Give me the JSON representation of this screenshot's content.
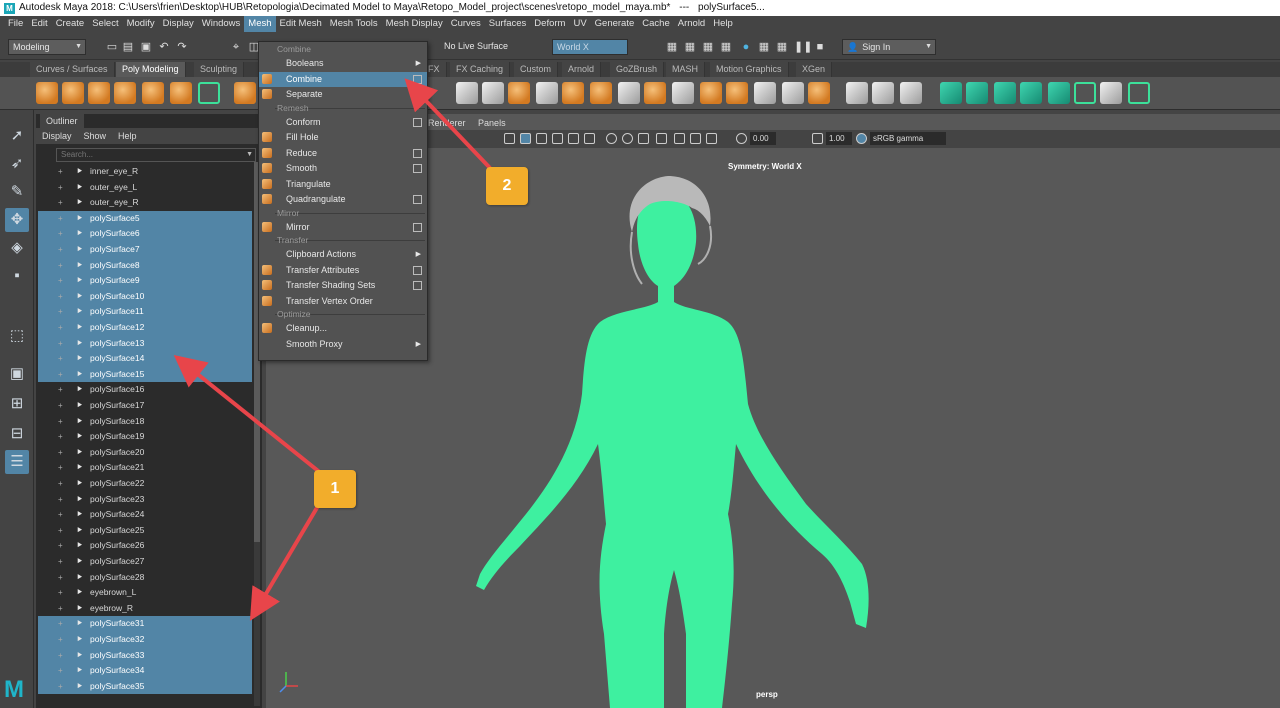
{
  "title": {
    "app": "Autodesk Maya 2018: C:\\Users\\frien\\Desktop\\HUB\\Retopologia\\Decimated Model to Maya\\Retopo_Model_project\\scenes\\retopo_model_maya.mb*",
    "separator": "---",
    "object": "polySurface5..."
  },
  "menubar": [
    "File",
    "Edit",
    "Create",
    "Select",
    "Modify",
    "Display",
    "Windows",
    "Mesh",
    "Edit Mesh",
    "Mesh Tools",
    "Mesh Display",
    "Curves",
    "Surfaces",
    "Deform",
    "UV",
    "Generate",
    "Cache",
    "Arnold",
    "Help"
  ],
  "active_menu": "Mesh",
  "statusline": {
    "mode": "Modeling",
    "live_surface": "No Live Surface",
    "symmetry": "World X",
    "sign_in": "Sign In"
  },
  "shelf_tabs": [
    "Curves / Surfaces",
    "Poly Modeling",
    "Sculpting",
    "FX",
    "FX Caching",
    "Custom",
    "Arnold",
    "GoZBrush",
    "MASH",
    "Motion Graphics",
    "XGen"
  ],
  "active_shelf_tab": "Poly Modeling",
  "outliner": {
    "tab": "Outliner",
    "menu": [
      "Display",
      "Show",
      "Help"
    ],
    "search_placeholder": "Search...",
    "rows": [
      {
        "name": "inner_eye_R",
        "selected": false
      },
      {
        "name": "outer_eye_L",
        "selected": false
      },
      {
        "name": "outer_eye_R",
        "selected": false
      },
      {
        "name": "polySurface5",
        "selected": true
      },
      {
        "name": "polySurface6",
        "selected": true
      },
      {
        "name": "polySurface7",
        "selected": true
      },
      {
        "name": "polySurface8",
        "selected": true
      },
      {
        "name": "polySurface9",
        "selected": true
      },
      {
        "name": "polySurface10",
        "selected": true
      },
      {
        "name": "polySurface11",
        "selected": true
      },
      {
        "name": "polySurface12",
        "selected": true
      },
      {
        "name": "polySurface13",
        "selected": true
      },
      {
        "name": "polySurface14",
        "selected": true
      },
      {
        "name": "polySurface15",
        "selected": true
      },
      {
        "name": "polySurface16",
        "selected": false
      },
      {
        "name": "polySurface17",
        "selected": false
      },
      {
        "name": "polySurface18",
        "selected": false
      },
      {
        "name": "polySurface19",
        "selected": false
      },
      {
        "name": "polySurface20",
        "selected": false
      },
      {
        "name": "polySurface21",
        "selected": false
      },
      {
        "name": "polySurface22",
        "selected": false
      },
      {
        "name": "polySurface23",
        "selected": false
      },
      {
        "name": "polySurface24",
        "selected": false
      },
      {
        "name": "polySurface25",
        "selected": false
      },
      {
        "name": "polySurface26",
        "selected": false
      },
      {
        "name": "polySurface27",
        "selected": false
      },
      {
        "name": "polySurface28",
        "selected": false
      },
      {
        "name": "eyebrown_L",
        "selected": false
      },
      {
        "name": "eyebrow_R",
        "selected": false
      },
      {
        "name": "polySurface31",
        "selected": true
      },
      {
        "name": "polySurface32",
        "selected": true
      },
      {
        "name": "polySurface33",
        "selected": true
      },
      {
        "name": "polySurface34",
        "selected": true
      },
      {
        "name": "polySurface35",
        "selected": true
      }
    ]
  },
  "mesh_menu": {
    "sections": [
      {
        "header": "Combine",
        "items": [
          {
            "label": "Booleans",
            "option": false,
            "submenu": true,
            "icon": false
          },
          {
            "label": "Combine",
            "option": true,
            "submenu": false,
            "icon": true,
            "active": true
          },
          {
            "label": "Separate",
            "option": false,
            "submenu": false,
            "icon": true
          }
        ]
      },
      {
        "header": "Remesh",
        "items": [
          {
            "label": "Conform",
            "option": true,
            "submenu": false,
            "icon": false
          },
          {
            "label": "Fill Hole",
            "option": false,
            "submenu": false,
            "icon": true
          },
          {
            "label": "Reduce",
            "option": true,
            "submenu": false,
            "icon": true
          },
          {
            "label": "Smooth",
            "option": true,
            "submenu": false,
            "icon": true
          },
          {
            "label": "Triangulate",
            "option": false,
            "submenu": false,
            "icon": true
          },
          {
            "label": "Quadrangulate",
            "option": true,
            "submenu": false,
            "icon": true
          }
        ]
      },
      {
        "header": "Mirror",
        "items": [
          {
            "label": "Mirror",
            "option": true,
            "submenu": false,
            "icon": true
          }
        ]
      },
      {
        "header": "Transfer",
        "items": [
          {
            "label": "Clipboard Actions",
            "option": false,
            "submenu": true,
            "icon": false
          },
          {
            "label": "Transfer Attributes",
            "option": true,
            "submenu": false,
            "icon": true
          },
          {
            "label": "Transfer Shading Sets",
            "option": true,
            "submenu": false,
            "icon": true
          },
          {
            "label": "Transfer Vertex Order",
            "option": false,
            "submenu": false,
            "icon": true
          }
        ]
      },
      {
        "header": "Optimize",
        "items": [
          {
            "label": "Cleanup...",
            "option": false,
            "submenu": false,
            "icon": true
          },
          {
            "label": "Smooth Proxy",
            "option": false,
            "submenu": true,
            "icon": false
          }
        ]
      }
    ]
  },
  "viewport": {
    "menu": [
      "Renderer",
      "Panels"
    ],
    "value1": "0.00",
    "value2": "1.00",
    "color_space": "sRGB gamma",
    "symmetry_label": "Symmetry: World X",
    "camera": "persp",
    "figure_color": "#3ef0a0",
    "hair_color": "#b9b9b9"
  },
  "callouts": {
    "one": "1",
    "two": "2"
  },
  "colors": {
    "selection": "#5285a6",
    "arrow": "#e8454a",
    "badge": "#f2ad2b"
  }
}
